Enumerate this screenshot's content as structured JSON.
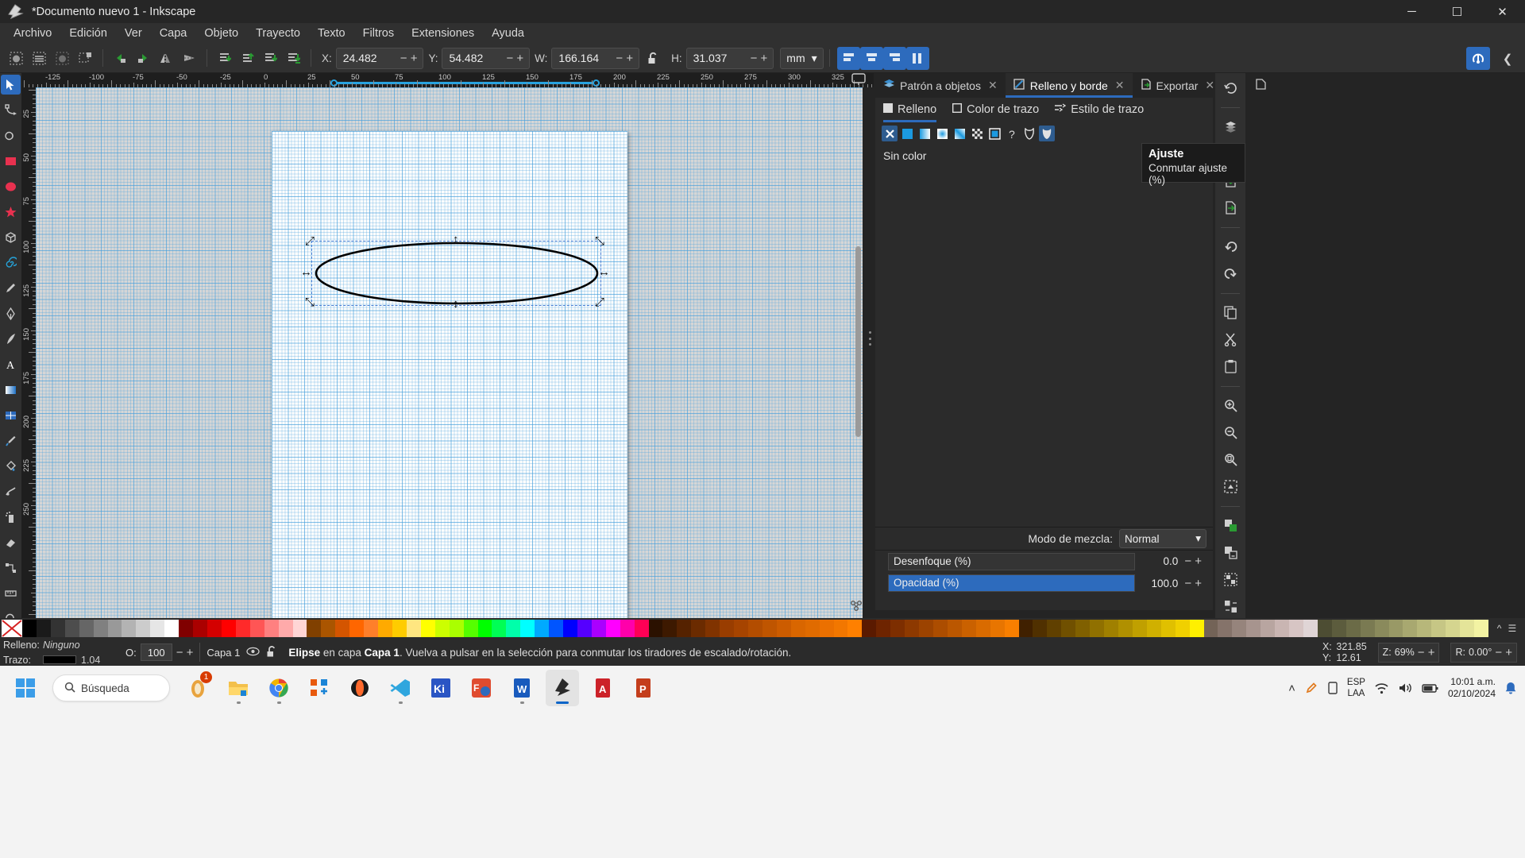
{
  "window": {
    "title": "*Documento nuevo 1 - Inkscape",
    "logo_icon": "inkscape-logo-icon",
    "controls": [
      {
        "name": "minimize-button",
        "glyph": "─"
      },
      {
        "name": "maximize-button",
        "glyph": "☐"
      },
      {
        "name": "close-button",
        "glyph": "✕"
      }
    ]
  },
  "menubar": {
    "items": [
      {
        "label": "Archivo"
      },
      {
        "label": "Edición"
      },
      {
        "label": "Ver"
      },
      {
        "label": "Capa"
      },
      {
        "label": "Objeto"
      },
      {
        "label": "Trayecto"
      },
      {
        "label": "Texto"
      },
      {
        "label": "Filtros"
      },
      {
        "label": "Extensiones"
      },
      {
        "label": "Ayuda"
      }
    ]
  },
  "toolbar": {
    "select_buttons": [
      {
        "name": "select-all-button",
        "icon": "select-all-icon"
      },
      {
        "name": "select-all-layers-button",
        "icon": "select-all-layers-icon"
      },
      {
        "name": "deselect-button",
        "icon": "deselect-icon"
      },
      {
        "name": "select-same-button",
        "icon": "select-same-icon"
      }
    ],
    "transform_buttons": [
      {
        "name": "rotate-ccw-button",
        "icon": "rotate-ccw-icon"
      },
      {
        "name": "rotate-cw-button",
        "icon": "rotate-cw-icon"
      },
      {
        "name": "flip-horizontal-button",
        "icon": "flip-horizontal-icon"
      },
      {
        "name": "flip-vertical-button",
        "icon": "flip-vertical-icon"
      }
    ],
    "zorder_buttons": [
      {
        "name": "raise-to-top-button",
        "icon": "raise-to-top-icon"
      },
      {
        "name": "raise-button",
        "icon": "raise-icon"
      },
      {
        "name": "lower-button",
        "icon": "lower-icon"
      },
      {
        "name": "lower-to-bottom-button",
        "icon": "lower-to-bottom-icon"
      }
    ],
    "fields": [
      {
        "name": "x-field",
        "label": "X:",
        "value": "24.482"
      },
      {
        "name": "y-field",
        "label": "Y:",
        "value": "54.482"
      },
      {
        "name": "w-field",
        "label": "W:",
        "value": "166.164"
      },
      {
        "name": "h-field",
        "label": "H:",
        "value": "31.037"
      }
    ],
    "lock_icon": "lock-open-icon",
    "unit": "mm",
    "unit_caret": "▾",
    "snap_button": {
      "name": "snap-toggle-button",
      "icon": "snap-icon"
    },
    "snap_more": "❮"
  },
  "tooltip": {
    "title": "Ajuste",
    "body": "Conmutar ajuste (%)"
  },
  "toolbox": {
    "tools": [
      {
        "name": "selector-tool",
        "icon": "arrow-cursor-icon",
        "active": true
      },
      {
        "name": "node-tool",
        "icon": "node-editor-icon"
      },
      {
        "name": "shape-builder-tool",
        "icon": "shape-builder-icon"
      },
      {
        "name": "rectangle-tool",
        "icon": "rectangle-icon"
      },
      {
        "name": "ellipse-tool",
        "icon": "ellipse-icon"
      },
      {
        "name": "star-tool",
        "icon": "star-icon"
      },
      {
        "name": "box3d-tool",
        "icon": "cube-3d-icon"
      },
      {
        "name": "spiral-tool",
        "icon": "spiral-icon"
      },
      {
        "name": "pencil-tool",
        "icon": "pencil-icon"
      },
      {
        "name": "bezier-tool",
        "icon": "bezier-pen-icon"
      },
      {
        "name": "calligraphy-tool",
        "icon": "calligraphy-icon"
      },
      {
        "name": "text-tool",
        "icon": "text-a-icon"
      },
      {
        "name": "gradient-tool",
        "icon": "gradient-icon"
      },
      {
        "name": "mesh-tool",
        "icon": "mesh-gradient-icon"
      },
      {
        "name": "dropper-tool",
        "icon": "eyedropper-icon"
      },
      {
        "name": "paintbucket-tool",
        "icon": "paint-bucket-icon"
      },
      {
        "name": "tweak-tool",
        "icon": "tweak-icon"
      },
      {
        "name": "spray-tool",
        "icon": "spray-can-icon"
      },
      {
        "name": "eraser-tool",
        "icon": "eraser-icon"
      },
      {
        "name": "connector-tool",
        "icon": "connector-icon"
      },
      {
        "name": "measure-tool",
        "icon": "measure-ruler-icon"
      },
      {
        "name": "zoom-tool",
        "icon": "magnifier-icon"
      },
      {
        "name": "pages-tool",
        "icon": "pages-icon"
      }
    ]
  },
  "rulers": {
    "horizontal_labels": [
      "-125",
      "-100",
      "-75",
      "-50",
      "-25",
      "0",
      "25",
      "50",
      "75",
      "100",
      "125",
      "150",
      "175",
      "200",
      "225",
      "250",
      "275",
      "300",
      "325"
    ],
    "vertical_labels": [
      "25",
      "50",
      "75",
      "100",
      "125",
      "150",
      "175",
      "200",
      "225",
      "250"
    ],
    "desk_button": "desk-view-icon"
  },
  "canvas": {
    "object": "ellipse",
    "selection_handles": [
      "scale-nw",
      "scale-n",
      "scale-ne",
      "scale-w",
      "scale-e",
      "scale-sw",
      "scale-s",
      "scale-se"
    ],
    "rotate_lock_icon": "rotate-lock-icon"
  },
  "dock": {
    "tabs": [
      {
        "label": "Patrón a objetos",
        "icon": "pattern-to-objects-icon",
        "active": false,
        "close": "✕"
      },
      {
        "label": "Relleno y borde",
        "icon": "fill-stroke-icon",
        "active": true,
        "close": "✕"
      },
      {
        "label": "Exportar",
        "icon": "export-icon",
        "active": false,
        "close": "✕"
      }
    ],
    "overflow_caret": "⌄",
    "new_doc_icon": "new-document-icon",
    "subtabs": [
      {
        "label": "Relleno",
        "icon": "fill-square-icon",
        "active": true
      },
      {
        "label": "Color de trazo",
        "icon": "stroke-square-icon",
        "active": false
      },
      {
        "label": "Estilo de trazo",
        "icon": "stroke-style-icon",
        "active": false
      }
    ],
    "paint_buttons": [
      {
        "name": "paint-none-button",
        "icon": "x-icon",
        "active": true
      },
      {
        "name": "paint-flat-button",
        "icon": "flat-color-icon",
        "active": false
      },
      {
        "name": "paint-linear-gradient-button",
        "icon": "linear-gradient-icon",
        "active": false
      },
      {
        "name": "paint-radial-gradient-button",
        "icon": "radial-gradient-icon",
        "active": false
      },
      {
        "name": "paint-mesh-gradient-button",
        "icon": "mesh-gradient-icon",
        "active": false
      },
      {
        "name": "paint-pattern-button",
        "icon": "pattern-icon",
        "active": false
      },
      {
        "name": "paint-swatch-button",
        "icon": "swatch-icon",
        "active": false
      },
      {
        "name": "paint-unknown-button",
        "icon": "question-mark-icon",
        "active": false
      },
      {
        "name": "fill-rule-evenodd-button",
        "icon": "fill-rule-evenodd-icon",
        "active": false
      },
      {
        "name": "fill-rule-nonzero-button",
        "icon": "fill-rule-nonzero-icon",
        "active": true
      }
    ],
    "no_paint_label": "Sin color",
    "blend_label": "Modo de mezcla:",
    "blend_value": "Normal",
    "blend_caret": "▾",
    "blur": {
      "label": "Desenfoque (%)",
      "value": "0.0",
      "percent": 0
    },
    "opacity": {
      "label": "Opacidad (%)",
      "value": "100.0",
      "percent": 100
    }
  },
  "rail": {
    "buttons": [
      {
        "name": "undo-history-button",
        "icon": "undo-history-icon"
      },
      {
        "name": "layers-button",
        "icon": "layers-icon"
      },
      {
        "name": "print-button",
        "icon": "printer-icon"
      },
      {
        "name": "import-button",
        "icon": "import-icon"
      },
      {
        "name": "export-button",
        "icon": "export-doc-icon"
      },
      {
        "name": "undo-button",
        "icon": "undo-arrow-icon"
      },
      {
        "name": "redo-button",
        "icon": "redo-arrow-icon"
      },
      {
        "name": "copy-button",
        "icon": "copy-icon"
      },
      {
        "name": "cut-button",
        "icon": "scissors-icon"
      },
      {
        "name": "paste-button",
        "icon": "paste-icon"
      },
      {
        "name": "zoom-in-button",
        "icon": "zoom-in-icon"
      },
      {
        "name": "zoom-out-button",
        "icon": "zoom-out-icon"
      },
      {
        "name": "zoom-page-button",
        "icon": "zoom-page-icon"
      },
      {
        "name": "zoom-drawing-button",
        "icon": "zoom-drawing-icon"
      },
      {
        "name": "duplicate-button",
        "icon": "duplicate-icon"
      },
      {
        "name": "clone-button",
        "icon": "clone-icon"
      },
      {
        "name": "group-button",
        "icon": "group-icon"
      },
      {
        "name": "ungroup-button",
        "icon": "ungroup-icon"
      }
    ]
  },
  "statusbar": {
    "fill_key": "Relleno:",
    "fill_value": "Ninguno",
    "stroke_key": "Trazo:",
    "stroke_width": "1.04",
    "opacity_key": "O:",
    "opacity_value": "100",
    "layer_name": "Capa 1",
    "layer_visibility_icon": "eye-icon",
    "layer_lock_icon": "lock-open-icon",
    "message_object": "Elipse",
    "message_rest": " en capa ",
    "message_layer": "Capa 1",
    "message_tail": ". Vuelva a pulsar en la selección para conmutar los tiradores de escalado/rotación.",
    "coord_x_key": "X:",
    "coord_x": "321.85",
    "coord_y_key": "Y:",
    "coord_y": "12.61",
    "zoom_key": "Z:",
    "zoom_value": "69%",
    "rotate_key": "R:",
    "rotate_value": "0.00°"
  },
  "taskbar": {
    "start_icon": "windows-start-icon",
    "search_placeholder": "Búsqueda",
    "search_icon": "search-icon",
    "apps": [
      {
        "name": "taskbar-app-notifications",
        "icon": "bell-app-icon",
        "badge": "1",
        "color": "#e8a33d",
        "running": false
      },
      {
        "name": "taskbar-app-file-explorer",
        "icon": "folder-icon",
        "color": "#f3c04b",
        "running": true
      },
      {
        "name": "taskbar-app-chrome",
        "icon": "chrome-icon",
        "color": "#4285f4",
        "running": true
      },
      {
        "name": "taskbar-app-store",
        "icon": "store-icon",
        "color": "#e8590c",
        "running": false
      },
      {
        "name": "taskbar-app-opera",
        "icon": "opera-icon",
        "color": "#ff1b2d",
        "running": false
      },
      {
        "name": "taskbar-app-vscode",
        "icon": "vscode-icon",
        "color": "#2fa6de",
        "running": true
      },
      {
        "name": "taskbar-app-kicad",
        "icon": "kicad-icon",
        "color": "#2a55c4",
        "running": false
      },
      {
        "name": "taskbar-app-fusion",
        "icon": "fusion-icon",
        "color": "#e04b2f",
        "running": true
      },
      {
        "name": "taskbar-app-word",
        "icon": "word-icon",
        "color": "#185abd",
        "running": true
      },
      {
        "name": "taskbar-app-inkscape",
        "icon": "inkscape-icon",
        "color": "#2b2b2b",
        "running": true,
        "active": true
      },
      {
        "name": "taskbar-app-acrobat",
        "icon": "acrobat-icon",
        "color": "#cc2229",
        "running": false
      },
      {
        "name": "taskbar-app-powerpoint",
        "icon": "powerpoint-icon",
        "color": "#c43e1c",
        "running": false
      }
    ],
    "tray": {
      "chevron": "˄",
      "icons": [
        "pen-tray-icon",
        "battery-tray-icon",
        "wifi-icon",
        "volume-icon",
        "battery-icon"
      ],
      "lang_line1": "ESP",
      "lang_line2": "LAA",
      "time": "10:01 a.m.",
      "date": "02/10/2024",
      "notification_icon": "notification-bell-icon"
    }
  },
  "colors": {
    "accent": "#2d6bbd",
    "panel": "#2b2b2b",
    "toolbar": "#303030",
    "canvas_bg": "#d6d6d6",
    "grid": "#46a0dc",
    "guide": "#29a3e0",
    "selection": "#4a7fd4"
  },
  "palette": {
    "none_label": "X",
    "swatches": [
      "#000000",
      "#1a1a1a",
      "#333333",
      "#4d4d4d",
      "#666666",
      "#808080",
      "#999999",
      "#b3b3b3",
      "#cccccc",
      "#e6e6e6",
      "#ffffff",
      "#800000",
      "#aa0000",
      "#d40000",
      "#ff0000",
      "#ff2a2a",
      "#ff5555",
      "#ff8080",
      "#ffaaaa",
      "#ffd5d5",
      "#804000",
      "#aa5500",
      "#d45500",
      "#ff6600",
      "#ff7f2a",
      "#ffaa00",
      "#ffcc00",
      "#ffe680",
      "#ffff00",
      "#ccff00",
      "#aaff00",
      "#55ff00",
      "#00ff00",
      "#00ff55",
      "#00ffaa",
      "#00ffff",
      "#00aaff",
      "#0055ff",
      "#0000ff",
      "#5500ff",
      "#aa00ff",
      "#ff00ff",
      "#ff00aa",
      "#ff0055",
      "#2b1100",
      "#3d1900",
      "#552200",
      "#6b2b00",
      "#803300",
      "#993d00",
      "#a64400",
      "#b34d00",
      "#bf5500",
      "#cc5c00",
      "#d96600",
      "#e06b00",
      "#eb7000",
      "#f27700",
      "#ff8000",
      "#5a1a00",
      "#6e2400",
      "#7d2e00",
      "#8d3900",
      "#9c4300",
      "#ac4d00",
      "#bb5700",
      "#ca6100",
      "#d96b00",
      "#e87500",
      "#f87f00",
      "#402000",
      "#503000",
      "#604000",
      "#705000",
      "#806000",
      "#907000",
      "#a08000",
      "#b09000",
      "#c0a000",
      "#d0b000",
      "#e0c000",
      "#f0d000",
      "#fff000",
      "#736357",
      "#85736a",
      "#96847c",
      "#a7948e",
      "#b8a5a0",
      "#c9b5b2",
      "#d7c5c4",
      "#e0d5d6",
      "#4d4d33",
      "#5c5c3d",
      "#6b6b47",
      "#7a7a52",
      "#8a8a5c",
      "#999966",
      "#a8a870",
      "#b7b77a",
      "#c6c685",
      "#d5d58f",
      "#e4e499",
      "#f3f3a3"
    ]
  }
}
